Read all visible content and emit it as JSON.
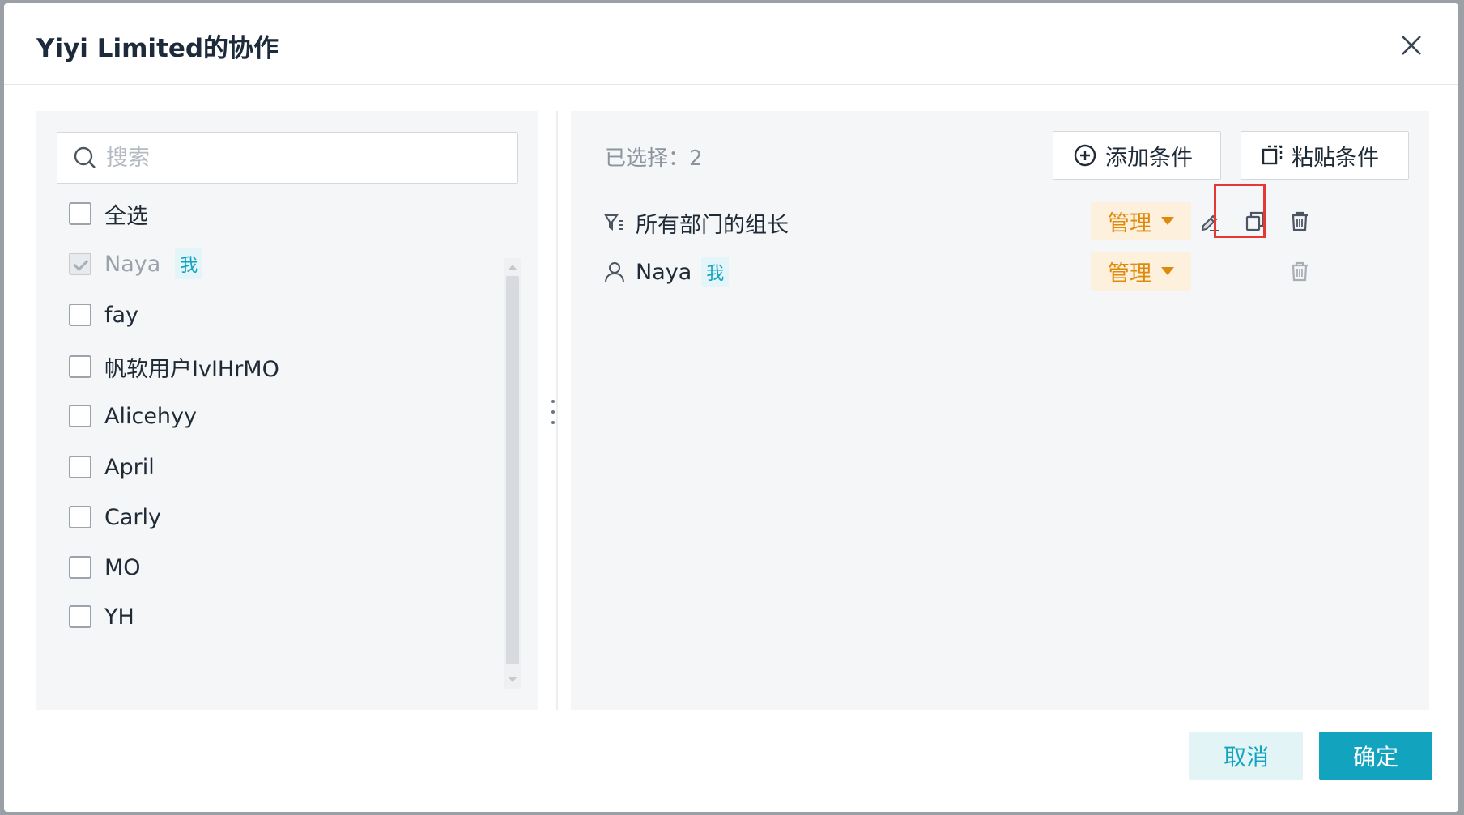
{
  "dialog": {
    "title": "Yiyi Limited的协作"
  },
  "left_panel": {
    "search_placeholder": "搜索",
    "select_all_label": "全选",
    "members": [
      {
        "name": "Naya",
        "tag": "我",
        "checked": true,
        "disabled": true
      },
      {
        "name": "fay",
        "checked": false
      },
      {
        "name": "帆软用户IvIHrMO",
        "checked": false
      },
      {
        "name": "Alicehyy",
        "checked": false
      },
      {
        "name": "April",
        "checked": false
      },
      {
        "name": "Carly",
        "checked": false
      },
      {
        "name": "MO",
        "checked": false
      },
      {
        "name": "YH",
        "checked": false
      }
    ]
  },
  "right_panel": {
    "selected_label": "已选择：",
    "selected_count": "2",
    "add_condition_label": "添加条件",
    "paste_condition_label": "粘贴条件",
    "entries": [
      {
        "name": "所有部门的组长",
        "type": "condition",
        "permission": "管理"
      },
      {
        "name": "Naya",
        "tag": "我",
        "type": "user",
        "permission": "管理"
      }
    ]
  },
  "footer": {
    "cancel_label": "取消",
    "ok_label": "确定"
  },
  "colors": {
    "accent": "#12a3bf",
    "permission_text": "#e08a0c",
    "permission_bg": "#fdf0dc",
    "highlight": "#e53935"
  }
}
